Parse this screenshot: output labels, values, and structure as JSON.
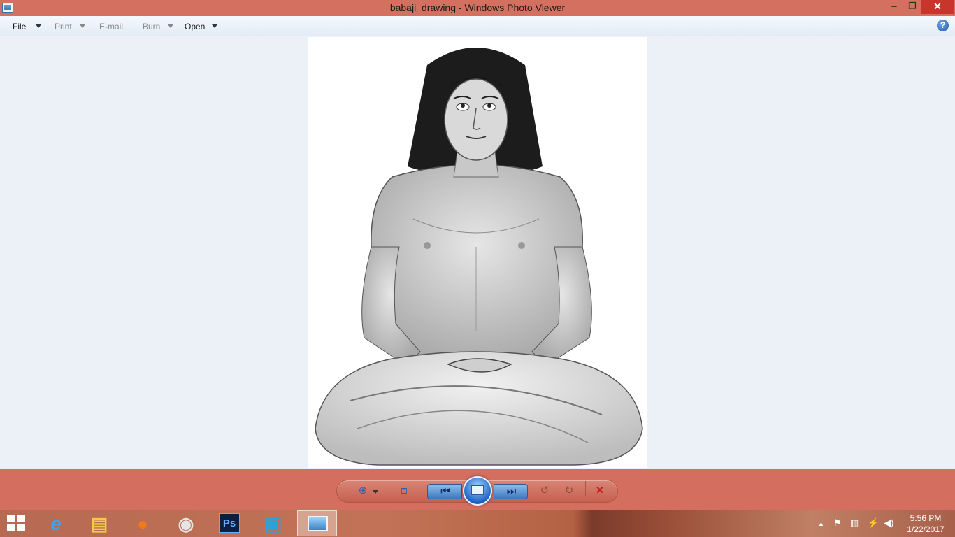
{
  "window": {
    "title": "babaji_drawing - Windows Photo Viewer",
    "min_glyph": "–",
    "max_glyph": "❐",
    "close_glyph": "✕"
  },
  "menu": {
    "file": "File",
    "print": "Print",
    "email": "E-mail",
    "burn": "Burn",
    "open": "Open",
    "help_glyph": "?"
  },
  "controls": {
    "zoom_glyph": "⊕",
    "actual_size_glyph": "⧈",
    "prev_glyph": "⏮",
    "next_glyph": "⏭",
    "rotate_ccw_glyph": "↺",
    "rotate_cw_glyph": "↻",
    "delete_glyph": "✕"
  },
  "taskbar": {
    "apps": [
      {
        "name": "ie",
        "glyph": "e"
      },
      {
        "name": "explorer",
        "glyph": "▤"
      },
      {
        "name": "firefox",
        "glyph": "●"
      },
      {
        "name": "chrome",
        "glyph": "◉"
      },
      {
        "name": "photoshop",
        "glyph": "Ps"
      },
      {
        "name": "virtualbox",
        "glyph": "▣"
      }
    ],
    "tray_glyphs": {
      "up": "▲",
      "flag": "⚑",
      "network": "▥",
      "power": "⚡",
      "volume": "◀)"
    },
    "time": "5:56 PM",
    "date": "1/22/2017"
  },
  "colors": {
    "titlebar": "#d4705f",
    "controlbar": "#d46e5e",
    "viewer_bg": "#ecf1f8",
    "close_button": "#c7352c"
  }
}
